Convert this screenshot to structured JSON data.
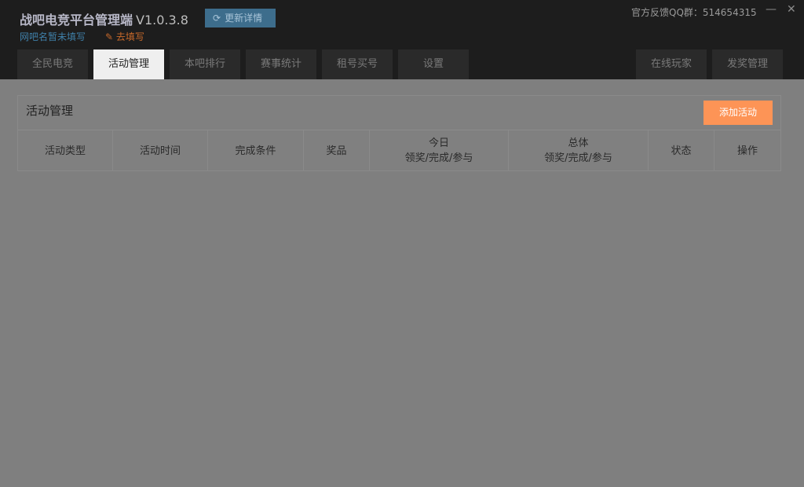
{
  "app": {
    "title": "战吧电竞平台管理端",
    "version": "V1.0.3.8",
    "update_label": "更新详情",
    "netbar_name": "网吧名暂未填写",
    "fill_label": "去填写",
    "qq_group": "官方反馈QQ群：514654315"
  },
  "tabs": [
    "全民电竞",
    "活动管理",
    "本吧排行",
    "赛事统计",
    "租号买号",
    "设置"
  ],
  "right_tabs": [
    "在线玩家",
    "发奖管理"
  ],
  "panel": {
    "title": "活动管理",
    "add_label": "添加活动",
    "columns": [
      {
        "l1": "活动类型"
      },
      {
        "l1": "活动时间"
      },
      {
        "l1": "完成条件"
      },
      {
        "l1": "奖品"
      },
      {
        "l1": "今日",
        "l2": "领奖/完成/参与"
      },
      {
        "l1": "总体",
        "l2": "领奖/完成/参与"
      },
      {
        "l1": "状态"
      },
      {
        "l1": "操作"
      }
    ]
  }
}
